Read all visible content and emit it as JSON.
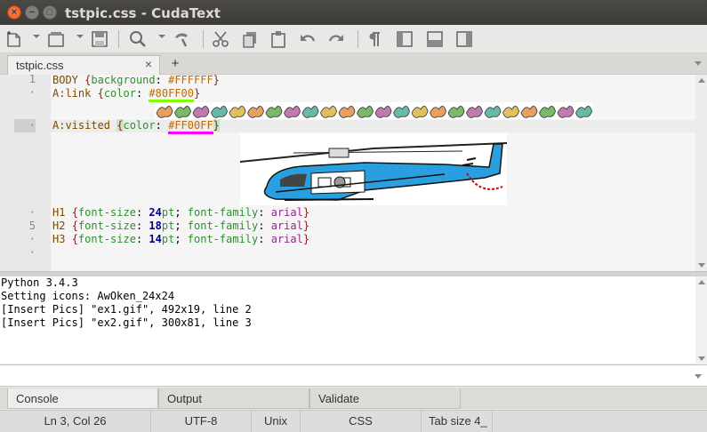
{
  "window": {
    "title": "tstpic.css - CudaText",
    "close_glyph": "×",
    "min_glyph": "−",
    "max_glyph": "□"
  },
  "toolbar": {
    "icons": [
      "new-file-icon",
      "open-file-icon",
      "save-icon",
      "find-icon",
      "goto-icon",
      "cut-icon",
      "copy-icon",
      "paste-icon",
      "undo-icon",
      "redo-icon",
      "show-unprinted-icon",
      "toggle-sidebar-icon",
      "toggle-bottom-panel-icon",
      "toggle-side-panel-icon"
    ]
  },
  "tabs": {
    "active_label": "tstpic.css",
    "close_glyph": "×",
    "add_glyph": "+"
  },
  "editor": {
    "gutter": [
      "1",
      "·",
      "·",
      "·",
      "5",
      "·",
      "·"
    ],
    "lines": {
      "l1": {
        "sel": "BODY",
        "open": "{",
        "prop": "background",
        "colon": ":",
        "val": "#FFFFFF",
        "close": "}"
      },
      "l2": {
        "sel": "A",
        "pseudo": ":link",
        "open": "{",
        "prop": "color",
        "colon": ":",
        "val": "#80FF00",
        "close": "}"
      },
      "l3": {
        "sel": "A",
        "pseudo": ":visited",
        "open": "{",
        "prop": "color",
        "colon": ":",
        "val": "#FF00FF",
        "close": "}"
      },
      "l4": {
        "sel": "H1",
        "open": "{",
        "prop1": "font-size",
        "num": "24",
        "unit": "pt",
        "semi": ";",
        "prop2": "font-family",
        "val2": "arial",
        "close": "}"
      },
      "l5": {
        "sel": "H2",
        "open": "{",
        "prop1": "font-size",
        "num": "18",
        "unit": "pt",
        "semi": ";",
        "prop2": "font-family",
        "val2": "arial",
        "close": "}"
      },
      "l6": {
        "sel": "H3",
        "open": "{",
        "prop1": "font-size",
        "num": "14",
        "unit": "pt",
        "semi": ";",
        "prop2": "font-family",
        "val2": "arial",
        "close": "}"
      }
    },
    "underline_colors": {
      "green": "#80FF00",
      "magenta": "#FF00FF"
    }
  },
  "console": {
    "lines": [
      "Python 3.4.3",
      "Setting icons: AwOken_24x24",
      "[Insert Pics] \"ex1.gif\", 492x19, line 2",
      "[Insert Pics] \"ex2.gif\", 300x81, line 3"
    ],
    "input_value": ""
  },
  "bottom_tabs": [
    "Console",
    "Output",
    "Validate"
  ],
  "statusbar": {
    "position": "Ln 3, Col 26",
    "encoding": "UTF-8",
    "line_ends": "Unix",
    "lexer": "CSS",
    "tab_size": "Tab size 4_"
  }
}
